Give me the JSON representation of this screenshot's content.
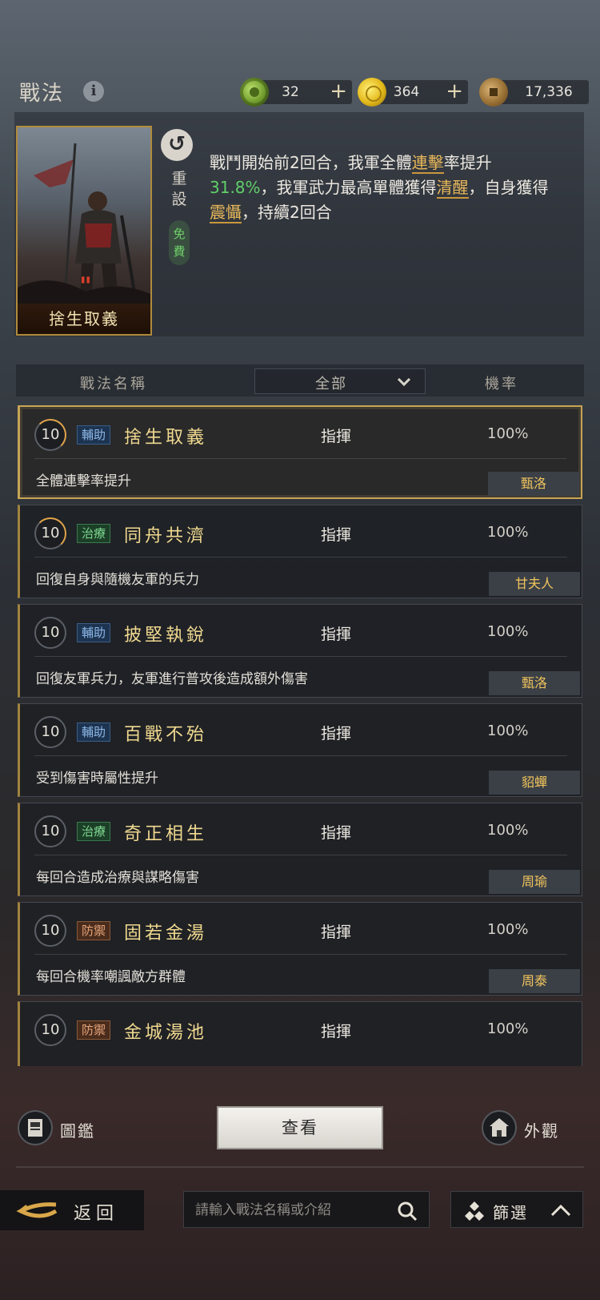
{
  "header": {
    "title": "戰法",
    "currencies": [
      {
        "icon": "jade-coin-icon",
        "value": "32",
        "has_add": true
      },
      {
        "icon": "gold-coin-icon",
        "value": "364",
        "has_add": true
      },
      {
        "icon": "copper-coin-icon",
        "value": "17,336",
        "has_add": false
      }
    ],
    "add_label": "+"
  },
  "selected_tactic": {
    "portrait_name": "捨生取義",
    "reset_label": "重設",
    "free_label": "免費",
    "desc": {
      "p1": "戰鬥開始前2回合，我軍全體",
      "kw1": "連擊",
      "p2": "率提升",
      "num": "31.8%",
      "p3": "，我軍武力最高單體獲得",
      "kw2": "清醒",
      "p4": "，自身獲得",
      "kw3": "震懾",
      "p5": "，持續2回合"
    }
  },
  "table_header": {
    "name": "戰法名稱",
    "filter": "全部",
    "rate": "機率"
  },
  "tactics": [
    {
      "level": "10",
      "tag": "輔助",
      "tag_class": "aux",
      "name": "捨生取義",
      "type": "指揮",
      "rate": "100%",
      "effect": "全體連擊率提升",
      "hero": "甄洛",
      "selected": true,
      "arc": true
    },
    {
      "level": "10",
      "tag": "治療",
      "tag_class": "heal",
      "name": "同舟共濟",
      "type": "指揮",
      "rate": "100%",
      "effect": "回復自身與隨機友軍的兵力",
      "hero": "甘夫人",
      "selected": false,
      "arc": true
    },
    {
      "level": "10",
      "tag": "輔助",
      "tag_class": "aux",
      "name": "披堅執銳",
      "type": "指揮",
      "rate": "100%",
      "effect": "回復友軍兵力，友軍進行普攻後造成額外傷害",
      "hero": "甄洛",
      "selected": false,
      "arc": false
    },
    {
      "level": "10",
      "tag": "輔助",
      "tag_class": "aux",
      "name": "百戰不殆",
      "type": "指揮",
      "rate": "100%",
      "effect": "受到傷害時屬性提升",
      "hero": "貂蟬",
      "selected": false,
      "arc": false
    },
    {
      "level": "10",
      "tag": "治療",
      "tag_class": "heal",
      "name": "奇正相生",
      "type": "指揮",
      "rate": "100%",
      "effect": "每回合造成治療與謀略傷害",
      "hero": "周瑜",
      "selected": false,
      "arc": false
    },
    {
      "level": "10",
      "tag": "防禦",
      "tag_class": "def",
      "name": "固若金湯",
      "type": "指揮",
      "rate": "100%",
      "effect": "每回合機率嘲諷敵方群體",
      "hero": "周泰",
      "selected": false,
      "arc": false
    },
    {
      "level": "10",
      "tag": "防禦",
      "tag_class": "def",
      "name": "金城湯池",
      "type": "指揮",
      "rate": "100%",
      "effect": "",
      "hero": "",
      "selected": false,
      "arc": false
    }
  ],
  "bottom": {
    "codex_label": "圖鑑",
    "view_label": "查看",
    "appearance_label": "外觀",
    "back_label": "返回",
    "search_placeholder": "請輸入戰法名稱或介紹",
    "filter_label": "篩選"
  }
}
